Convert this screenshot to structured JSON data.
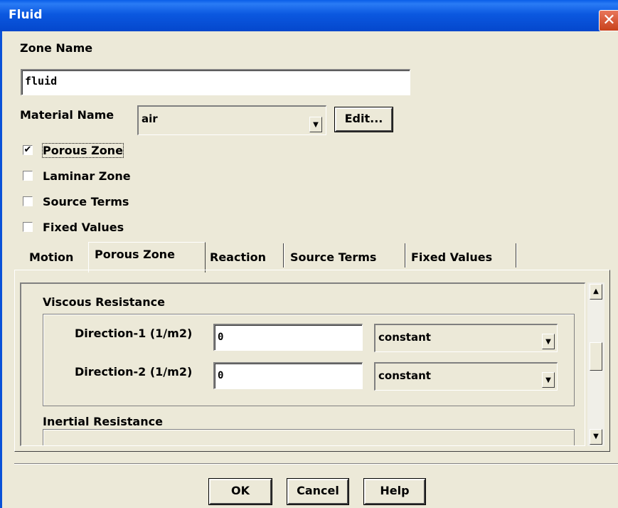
{
  "window": {
    "title": "Fluid",
    "close_glyph": "✕"
  },
  "zone": {
    "label": "Zone Name",
    "value": "fluid"
  },
  "material": {
    "label": "Material Name",
    "value": "air",
    "edit_label": "Edit..."
  },
  "checkboxes": {
    "porous": {
      "label": "Porous Zone",
      "checked": true
    },
    "laminar": {
      "label": "Laminar Zone",
      "checked": false
    },
    "source": {
      "label": "Source Terms",
      "checked": false
    },
    "fixed": {
      "label": "Fixed Values",
      "checked": false
    }
  },
  "tabs": [
    "Motion",
    "Porous Zone",
    "Reaction",
    "Source Terms",
    "Fixed Values"
  ],
  "active_tab": "Porous Zone",
  "viscous": {
    "title": "Viscous Resistance",
    "dir1": {
      "label": "Direction-1 (1/m2)",
      "value": "0",
      "method": "constant"
    },
    "dir2": {
      "label": "Direction-2 (1/m2)",
      "value": "0",
      "method": "constant"
    }
  },
  "inertial": {
    "title": "Inertial Resistance"
  },
  "buttons": {
    "ok": "OK",
    "cancel": "Cancel",
    "help": "Help"
  },
  "icons": {
    "check": "✔",
    "arrow_down": "▼",
    "arrow_up": "▲"
  },
  "colors": {
    "titlebar": "#0A5EE8",
    "face": "#ECE9D8",
    "close": "#D2522C"
  }
}
